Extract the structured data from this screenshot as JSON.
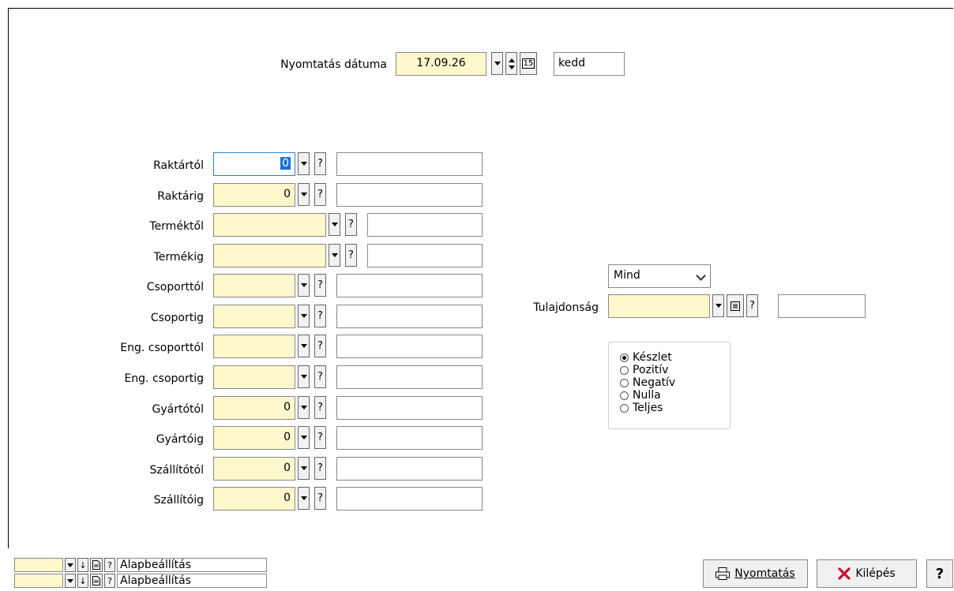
{
  "print_date": {
    "label": "Nyomtatás dátuma",
    "value": "17.09.26",
    "weekday": "kedd"
  },
  "fields": {
    "raktartol": {
      "label": "Raktártól",
      "value": "0"
    },
    "raktarig": {
      "label": "Raktárig",
      "value": "0"
    },
    "termektol": {
      "label": "Terméktől",
      "value": ""
    },
    "termekig": {
      "label": "Termékig",
      "value": ""
    },
    "csoporttol": {
      "label": "Csoporttól",
      "value": ""
    },
    "csoportig": {
      "label": "Csoportig",
      "value": ""
    },
    "eng_csoporttol": {
      "label": "Eng. csoporttól",
      "value": ""
    },
    "eng_csoportig": {
      "label": "Eng. csoportig",
      "value": ""
    },
    "gyartotol": {
      "label": "Gyártótól",
      "value": "0"
    },
    "gyartoig": {
      "label": "Gyártóig",
      "value": "0"
    },
    "szallitotol": {
      "label": "Szállítótól",
      "value": "0"
    },
    "szallitoig": {
      "label": "Szállítóig",
      "value": "0"
    }
  },
  "property": {
    "mode_selected": "Mind",
    "label": "Tulajdonság",
    "value": ""
  },
  "stock_filter": {
    "selected": "Készlet",
    "options": [
      "Készlet",
      "Pozitív",
      "Negatív",
      "Nulla",
      "Teljes"
    ]
  },
  "presets": [
    {
      "label": "Alapbeállítás"
    },
    {
      "label": "Alapbeállítás"
    }
  ],
  "buttons": {
    "print": "Nyomtatás",
    "exit": "Kilépés",
    "help": "?"
  },
  "glyphs": {
    "help": "?",
    "calendar": "15",
    "down_arrow": "↓"
  }
}
